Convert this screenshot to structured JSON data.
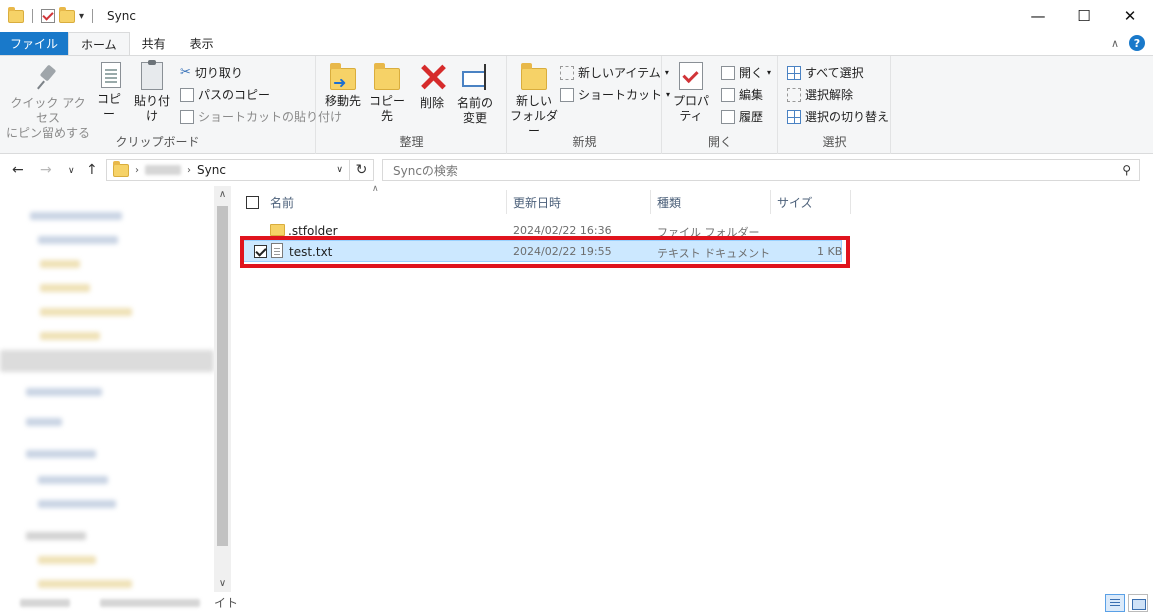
{
  "window": {
    "title": "Sync",
    "controls": {
      "minimize": "—",
      "maximize": "☐",
      "close": "✕"
    }
  },
  "ribbon_tabs": [
    {
      "label": "ファイル"
    },
    {
      "label": "ホーム"
    },
    {
      "label": "共有"
    },
    {
      "label": "表示"
    }
  ],
  "ribbon": {
    "clipboard": {
      "label": "クリップボード",
      "pin_line1": "クイック アクセス",
      "pin_line2": "にピン留めする",
      "copy": "コピー",
      "paste": "貼り付け",
      "cut": "切り取り",
      "copy_path": "パスのコピー",
      "paste_shortcut": "ショートカットの貼り付け"
    },
    "organize": {
      "label": "整理",
      "move_to": "移動先",
      "copy_to": "コピー先",
      "delete": "削除",
      "rename_line1": "名前の",
      "rename_line2": "変更"
    },
    "new": {
      "label": "新規",
      "new_folder_line1": "新しい",
      "new_folder_line2": "フォルダー",
      "new_item": "新しいアイテム",
      "easy_access": "ショートカット"
    },
    "open": {
      "label": "開く",
      "properties": "プロパティ",
      "open": "開く",
      "edit": "編集",
      "history": "履歴"
    },
    "select": {
      "label": "選択",
      "select_all": "すべて選択",
      "select_none": "選択解除",
      "invert": "選択の切り替え"
    }
  },
  "address": {
    "current": "Sync",
    "search_placeholder": "Syncの検索"
  },
  "columns": [
    {
      "label": "名前"
    },
    {
      "label": "更新日時"
    },
    {
      "label": "種類"
    },
    {
      "label": "サイズ"
    }
  ],
  "files": [
    {
      "name": ".stfolder",
      "modified": "2024/02/22 16:36",
      "type": "ファイル フォルダー",
      "size": "",
      "checked": false,
      "selected": false
    },
    {
      "name": "test.txt",
      "modified": "2024/02/22 19:55",
      "type": "テキスト ドキュメント",
      "size": "1 KB",
      "checked": true,
      "selected": true
    }
  ],
  "status": {
    "trailing": "イト"
  },
  "colors": {
    "accent": "#1979ca",
    "selection": "#cce8ff",
    "highlight_border": "#e0141e"
  }
}
